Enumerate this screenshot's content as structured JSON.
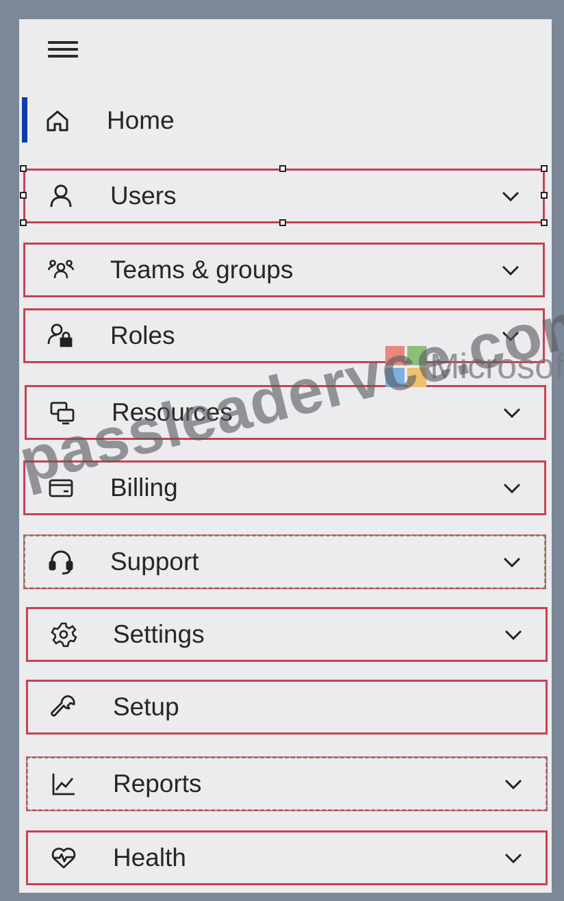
{
  "nav": {
    "menu_icon": "hamburger-icon",
    "items": [
      {
        "label": "Home",
        "icon": "home-icon",
        "expandable": false
      },
      {
        "label": "Users",
        "icon": "user-icon",
        "expandable": true
      },
      {
        "label": "Teams & groups",
        "icon": "teams-icon",
        "expandable": true
      },
      {
        "label": "Roles",
        "icon": "roles-icon",
        "expandable": true
      },
      {
        "label": "Resources",
        "icon": "resources-icon",
        "expandable": true
      },
      {
        "label": "Billing",
        "icon": "billing-icon",
        "expandable": true
      },
      {
        "label": "Support",
        "icon": "headset-icon",
        "expandable": true
      },
      {
        "label": "Settings",
        "icon": "gear-icon",
        "expandable": true
      },
      {
        "label": "Setup",
        "icon": "wrench-icon",
        "expandable": false
      },
      {
        "label": "Reports",
        "icon": "chart-icon",
        "expandable": true
      },
      {
        "label": "Health",
        "icon": "heart-icon",
        "expandable": true
      }
    ],
    "active": "Home"
  },
  "watermark": {
    "text": "passleadervce.com",
    "brand": "Microsoft"
  },
  "colors": {
    "active_indicator": "#0b3ea8",
    "highlight_border": "#c54250",
    "dashed_border": "#74a870",
    "frame": "#7b8898"
  }
}
